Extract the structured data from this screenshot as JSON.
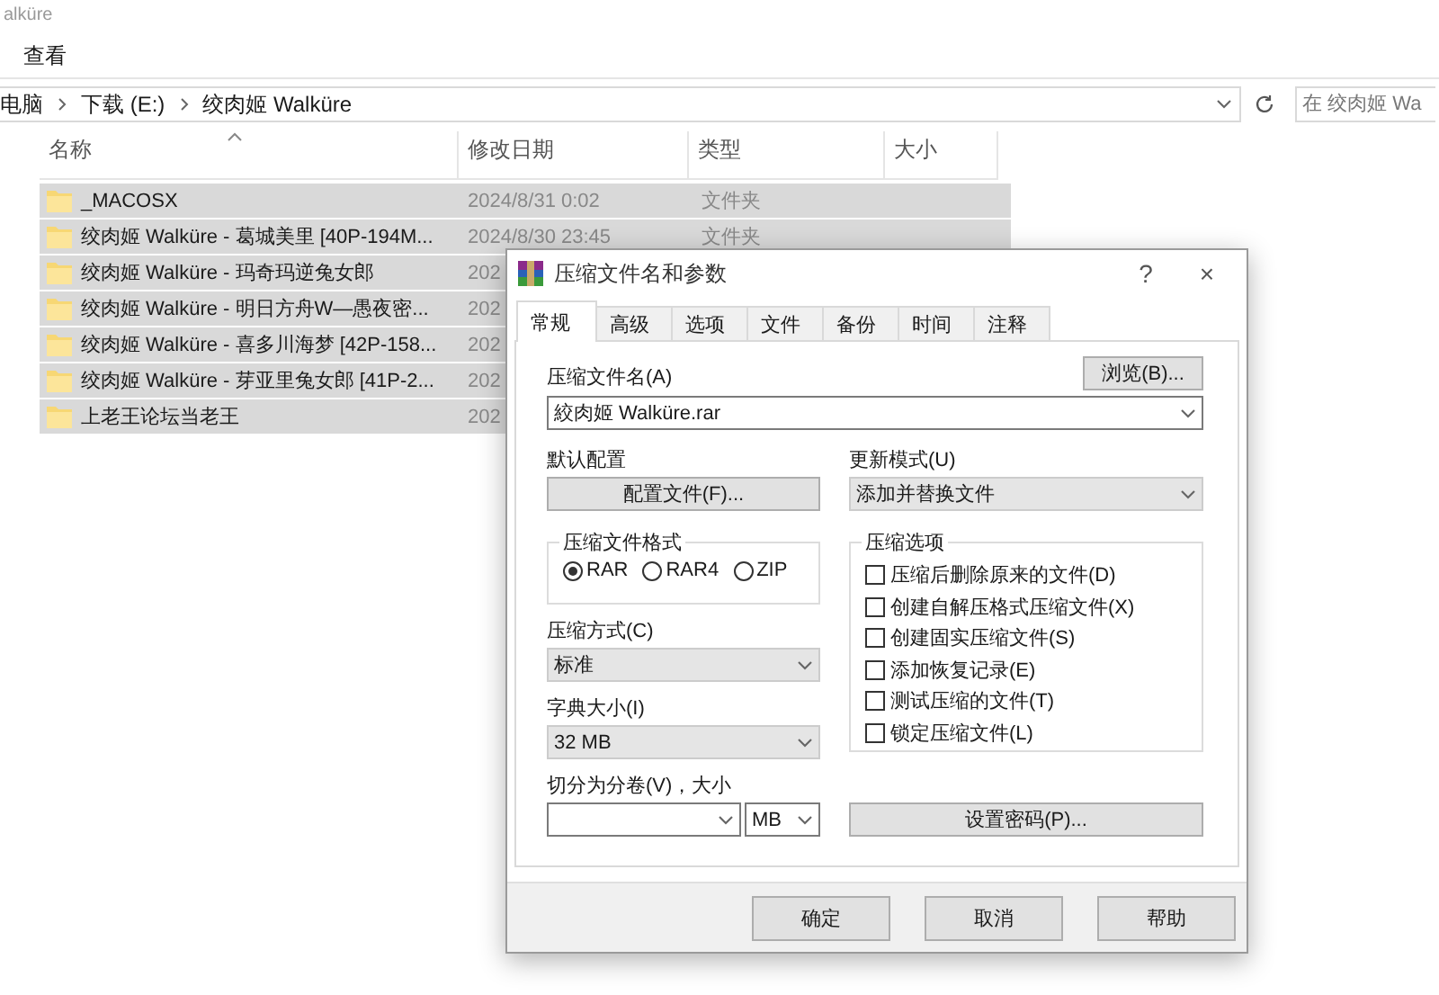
{
  "explorer": {
    "title": "alküre",
    "menu": [
      "查看"
    ],
    "breadcrumb": [
      "电脑",
      "下载 (E:)",
      "绞肉姬 Walküre"
    ],
    "search": {
      "placeholder": "在 绞肉姬 Wa"
    },
    "columns": [
      {
        "label": "名称",
        "sorted": true
      },
      {
        "label": "修改日期",
        "sorted": false
      },
      {
        "label": "类型",
        "sorted": false
      },
      {
        "label": "大小",
        "sorted": false
      }
    ],
    "rows": [
      {
        "name": "_MACOSX",
        "date": "2024/8/31 0:02",
        "type": "文件夹",
        "selected": true
      },
      {
        "name": "绞肉姬 Walküre - 葛城美里 [40P-194M...",
        "date": "2024/8/30 23:45",
        "type": "文件夹",
        "selected": true
      },
      {
        "name": "绞肉姬 Walküre - 玛奇玛逆兔女郎",
        "date": "202",
        "type": "",
        "selected": true
      },
      {
        "name": "绞肉姬 Walküre - 明日方舟W—愚夜密...",
        "date": "202",
        "type": "",
        "selected": true
      },
      {
        "name": "绞肉姬 Walküre - 喜多川海梦 [42P-158...",
        "date": "202",
        "type": "",
        "selected": true
      },
      {
        "name": "绞肉姬 Walküre - 芽亚里兔女郎 [41P-2...",
        "date": "202",
        "type": "",
        "selected": true
      },
      {
        "name": "上老王论坛当老王",
        "date": "202",
        "type": "",
        "selected": true
      }
    ]
  },
  "dialog": {
    "title": "压缩文件名和参数",
    "help": "?",
    "close": "×",
    "tabs": [
      {
        "label": "常规",
        "selected": true
      },
      {
        "label": "高级",
        "selected": false
      },
      {
        "label": "选项",
        "selected": false
      },
      {
        "label": "文件",
        "selected": false
      },
      {
        "label": "备份",
        "selected": false
      },
      {
        "label": "时间",
        "selected": false
      },
      {
        "label": "注释",
        "selected": false
      }
    ],
    "archive_name": {
      "label": "压缩文件名(A)",
      "value": "絞肉姬 Walküre.rar"
    },
    "browse_button": "浏览(B)...",
    "profile": {
      "label": "默认配置",
      "button": "配置文件(F)..."
    },
    "update_mode": {
      "label": "更新模式(U)",
      "value": "添加并替换文件"
    },
    "format": {
      "legend": "压缩文件格式",
      "options": [
        {
          "label": "RAR",
          "selected": true
        },
        {
          "label": "RAR4",
          "selected": false
        },
        {
          "label": "ZIP",
          "selected": false
        }
      ]
    },
    "method": {
      "label": "压缩方式(C)",
      "value": "标准"
    },
    "dictionary": {
      "label": "字典大小(I)",
      "value": "32 MB"
    },
    "volume": {
      "label": "切分为分卷(V)，大小",
      "unit": "MB"
    },
    "options": {
      "legend": "压缩选项",
      "items": [
        {
          "label": "压缩后删除原来的文件(D)",
          "checked": false
        },
        {
          "label": "创建自解压格式压缩文件(X)",
          "checked": false
        },
        {
          "label": "创建固实压缩文件(S)",
          "checked": false
        },
        {
          "label": "添加恢复记录(E)",
          "checked": false
        },
        {
          "label": "测试压缩的文件(T)",
          "checked": false
        },
        {
          "label": "锁定压缩文件(L)",
          "checked": false
        }
      ]
    },
    "password_button": "设置密码(P)...",
    "buttons": [
      "确定",
      "取消",
      "帮助"
    ]
  }
}
